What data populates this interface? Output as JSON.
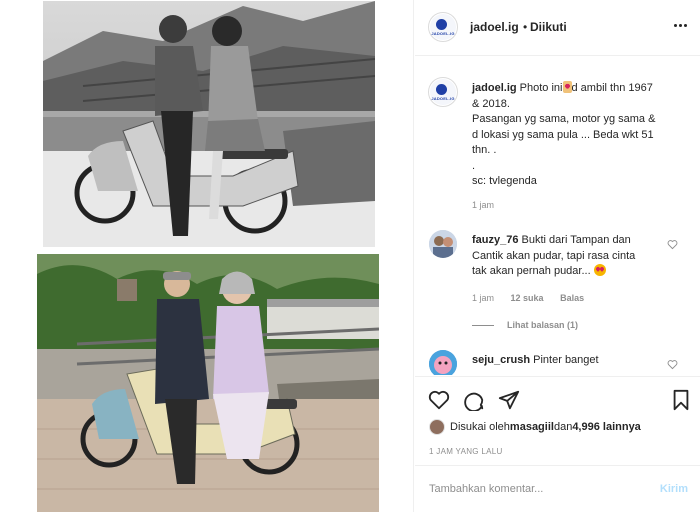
{
  "post": {
    "username": "jadoel.ig",
    "separator": "•",
    "follow_status": "Diikuti",
    "avatar_text": "JADOEL.IG"
  },
  "caption": {
    "username": "jadoel.ig",
    "line1": " Photo ini",
    "line1_end": "d ambil thn 1967",
    "line2": "& 2018.",
    "line3": "Pasangan yg sama, motor yg sama &",
    "line4": "d lokasi yg sama pula ... Beda wkt 51",
    "line5": "thn. .",
    "line6": ".",
    "line7": "sc: tvlegenda",
    "time": "1 jam"
  },
  "comments": [
    {
      "username": "fauzy_76",
      "line1": " Bukti dari Tampan dan",
      "line2": "Cantik akan pudar, tapi rasa cinta",
      "line3": "tak akan pernah pudar...",
      "time": "1 jam",
      "likes": "12 suka",
      "reply": "Balas"
    },
    {
      "username": "seju_crush",
      "line1": " Pinter banget"
    }
  ],
  "view_replies": "Lihat balasan (1)",
  "likes": {
    "prefix": "Disukai oleh ",
    "user": "masagiil",
    "middle": " dan ",
    "count": "4,996 lainnya"
  },
  "post_time": "1 JAM YANG LALU",
  "add_comment": {
    "placeholder": "Tambahkan komentar...",
    "post_label": "Kirim"
  },
  "icons": {
    "like": "heart-icon",
    "comment": "comment-icon",
    "share": "share-icon",
    "save": "bookmark-icon",
    "more": "more-icon"
  },
  "colors": {
    "text": "#262626",
    "secondary": "#8e8e8e",
    "border": "#efefef",
    "post_button_disabled": "#b2dffc",
    "logo_blue": "#1f3fa6"
  }
}
